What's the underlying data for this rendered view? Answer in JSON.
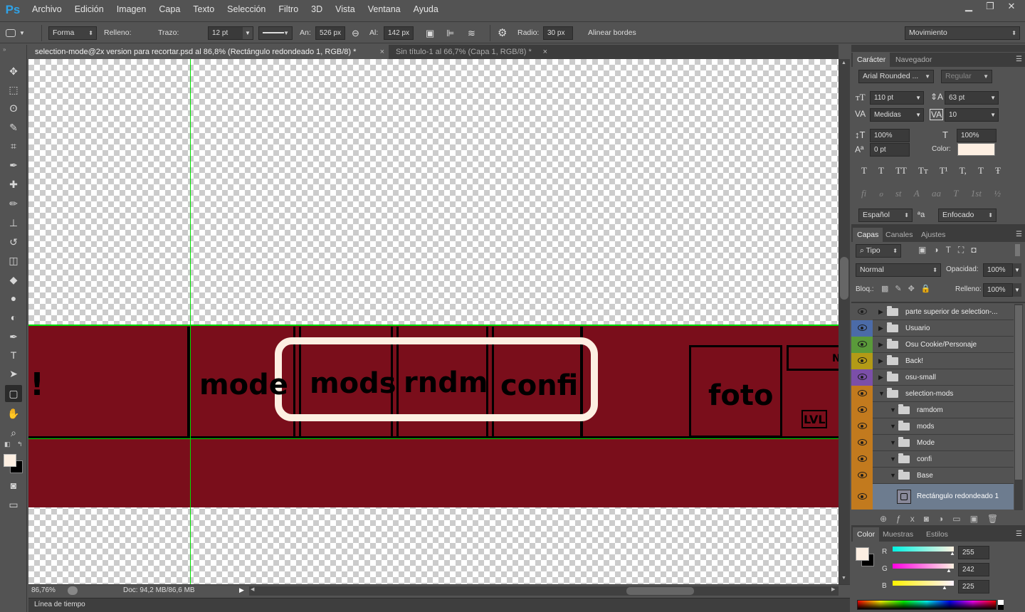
{
  "app": {
    "logo": "Ps"
  },
  "menu": [
    "Archivo",
    "Edición",
    "Imagen",
    "Capa",
    "Texto",
    "Selección",
    "Filtro",
    "3D",
    "Vista",
    "Ventana",
    "Ayuda"
  ],
  "window_controls": {
    "minimize": "▁",
    "restore": "❐",
    "close": "✕"
  },
  "options": {
    "mode": "Forma",
    "fill_label": "Relleno:",
    "stroke_label": "Trazo:",
    "stroke_width": "12 pt",
    "width_label": "An:",
    "width": "526 px",
    "height_label": "Al:",
    "height": "142 px",
    "radius_label": "Radio:",
    "radius": "30 px",
    "align_edges_label": "Alinear bordes",
    "align_edges_checked": true,
    "workspace": "Movimiento",
    "stroke_color": "#fdefe2"
  },
  "tabs": [
    {
      "label": "selection-mode@2x version para recortar.psd al 86,8% (Rectángulo redondeado 1, RGB/8) *",
      "active": true
    },
    {
      "label": "Sin título-1 al 66,7% (Capa 1, RGB/8) *",
      "active": false
    }
  ],
  "tools": [
    "move-icon",
    "marquee-icon",
    "lasso-icon",
    "quick-select-icon",
    "crop-icon",
    "eyedropper-icon",
    "healing-icon",
    "brush-icon",
    "stamp-icon",
    "history-brush-icon",
    "eraser-icon",
    "paint-bucket-icon",
    "blur-icon",
    "dodge-icon",
    "pen-icon",
    "type-icon",
    "path-select-icon",
    "rounded-rect-icon",
    "hand-icon",
    "zoom-icon"
  ],
  "canvas": {
    "bar_color": "#7a0e1b",
    "guide_color": "#00e000",
    "labels": {
      "exclaim": "!",
      "mode": "mode",
      "mods": "mods",
      "rndm": "rndm",
      "confi": "confi",
      "foto": "foto",
      "lvl": "LVL",
      "n": "N"
    }
  },
  "status": {
    "zoom": "86,76%",
    "doc": "Doc: 94,2 MB/86,6 MB"
  },
  "timeline": {
    "label": "Línea de tiempo"
  },
  "character": {
    "tabs": [
      "Carácter",
      "Navegador"
    ],
    "font_family": "Arial Rounded ...",
    "font_style": "Regular",
    "size": "110 pt",
    "leading": "63 pt",
    "kerning": "Medidas",
    "tracking": "10",
    "vscale": "100%",
    "hscale": "100%",
    "baseline": "0 pt",
    "color_label": "Color:",
    "color": "#fdefe2",
    "language": "Español",
    "aa_icon": "ªa",
    "antialias": "Enfocado",
    "style_buttons": [
      "T",
      "T",
      "TT",
      "Tт",
      "T¹",
      "T,",
      "T",
      "Ŧ"
    ],
    "ot_buttons": [
      "fi",
      "ℴ",
      "st",
      "A",
      "aa",
      "T",
      "1st",
      "½"
    ]
  },
  "layers_panel": {
    "tabs": [
      "Capas",
      "Canales",
      "Ajustes"
    ],
    "filter": "Tipo",
    "blend": "Normal",
    "opacity_label": "Opacidad:",
    "opacity": "100%",
    "lock_label": "Bloq.:",
    "fill_label": "Relleno:",
    "fill": "100%",
    "layers": [
      {
        "name": "parte superior de selection-...",
        "color": "#535353",
        "expanded": false,
        "indent": 0
      },
      {
        "name": "Usuario",
        "color": "#4b6ba8",
        "expanded": false,
        "indent": 0
      },
      {
        "name": "Osu Cookie/Personaje",
        "color": "#5a9a3a",
        "expanded": false,
        "indent": 0
      },
      {
        "name": "Back!",
        "color": "#b39a16",
        "expanded": false,
        "indent": 0
      },
      {
        "name": "osu-small",
        "color": "#7b4fa8",
        "expanded": false,
        "indent": 0
      },
      {
        "name": "selection-mods",
        "color": "#c27a1e",
        "expanded": true,
        "indent": 0
      },
      {
        "name": "ramdom",
        "color": "#c27a1e",
        "expanded": true,
        "indent": 1
      },
      {
        "name": "mods",
        "color": "#c27a1e",
        "expanded": true,
        "indent": 1
      },
      {
        "name": "Mode",
        "color": "#c27a1e",
        "expanded": true,
        "indent": 1
      },
      {
        "name": "confi",
        "color": "#c27a1e",
        "expanded": true,
        "indent": 1
      },
      {
        "name": "Base",
        "color": "#c27a1e",
        "expanded": true,
        "indent": 1
      }
    ],
    "selected_layer": "Rectángulo redondeado 1"
  },
  "color_panel": {
    "tabs": [
      "Color",
      "Muestras",
      "Estilos"
    ],
    "r_label": "R",
    "g_label": "G",
    "b_label": "B",
    "r": "255",
    "g": "242",
    "b": "225",
    "fg": "#fdefe2",
    "bg": "#000000"
  }
}
